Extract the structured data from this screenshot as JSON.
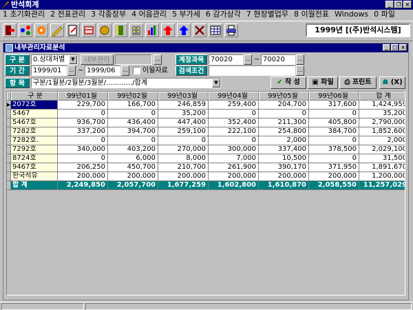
{
  "app": {
    "title": "반석회계"
  },
  "menu": [
    "1 초기화관리",
    "2 전표관리",
    "3 각종장부",
    "4 어음관리",
    "5 부가세",
    "6 감가상각",
    "7 현장별업무",
    "8 이월전표",
    "Windows",
    "0 파일"
  ],
  "toolbar": {
    "icons": [
      "exit-icon",
      "tree-icon",
      "palette-icon",
      "pencil-icon",
      "edit-doc-icon",
      "calculator-icon",
      "coin-icon",
      "book-icon",
      "building-icon",
      "chart-icon",
      "up-arrow-red-icon",
      "up-arrow-blue-icon",
      "tools-icon",
      "grid-icon",
      "printer-icon"
    ],
    "company": "1999년 [(주)반석시스템]"
  },
  "child": {
    "title": "내부관리자료분석"
  },
  "form": {
    "gubun_label": "구 분",
    "gubun_value": "0.상대처별",
    "naebu_label": "내부관리",
    "gigan_label": "기 간",
    "period_from": "1999/01",
    "period_to": "1999/06",
    "tilde": "~",
    "iwol_label": "이월자료",
    "account_label": "계정과목",
    "account_from": "70020",
    "account_to": "70020",
    "search_label": "검색조건",
    "hangmok_label": "항 목",
    "hangmok_value": "구분/1월분/2월분/3월분/............/합계",
    "btn_write": "작 성",
    "btn_file": "파일",
    "btn_print": "프린트",
    "btn_close": "(X)"
  },
  "table": {
    "headers": [
      "구 분",
      "99년01월",
      "99년02월",
      "99년03월",
      "99년04월",
      "99년05월",
      "99년06월",
      "합 계"
    ],
    "rows": [
      [
        "2072호",
        "229,700",
        "166,700",
        "246,859",
        "259,400",
        "204,700",
        "317,600",
        "1,424,959"
      ],
      [
        "5467",
        "0",
        "0",
        "35,200",
        "0",
        "0",
        "0",
        "35,200"
      ],
      [
        "5467호",
        "936,700",
        "436,400",
        "447,400",
        "352,400",
        "211,300",
        "405,800",
        "2,790,000"
      ],
      [
        "7282호",
        "337,200",
        "394,700",
        "259,100",
        "222,100",
        "254,800",
        "384,700",
        "1,852,600"
      ],
      [
        "7282호.",
        "0",
        "0",
        "0",
        "0",
        "2,000",
        "0",
        "2,000"
      ],
      [
        "7292호",
        "340,000",
        "403,200",
        "270,000",
        "300,000",
        "337,400",
        "378,500",
        "2,029,100"
      ],
      [
        "8724호",
        "0",
        "6,000",
        "8,000",
        "7,000",
        "10,500",
        "0",
        "31,500"
      ],
      [
        "9467호",
        "206,250",
        "450,700",
        "210,700",
        "261,900",
        "390,170",
        "371,950",
        "1,891,670"
      ],
      [
        "한국석유",
        "200,000",
        "200,000",
        "200,000",
        "200,000",
        "200,000",
        "200,000",
        "1,200,000"
      ]
    ],
    "total": [
      "합 계",
      "2,249,850",
      "2,057,700",
      "1,677,259",
      "1,602,800",
      "1,610,870",
      "2,058,550",
      "11,257,029"
    ]
  }
}
